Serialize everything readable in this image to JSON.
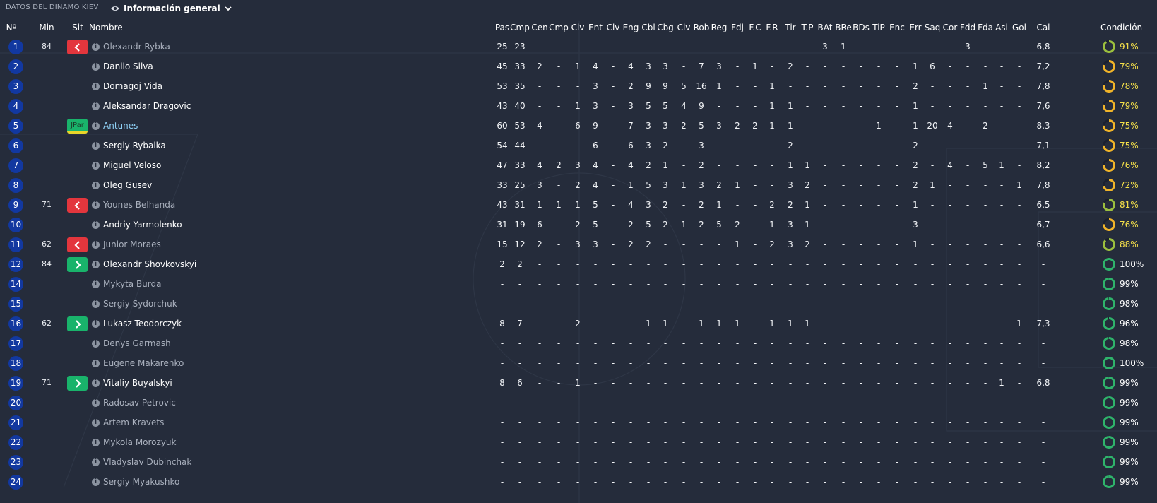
{
  "title": "DATOS DEL DINAMO KIEV",
  "view_selector": {
    "label": "Información general",
    "icon": "eye-icon"
  },
  "columns": [
    "Nº",
    "Min",
    "Sit",
    "Nombre",
    "Pas",
    "Cmp",
    "Cen",
    "Cmp",
    "Clv",
    "Ent",
    "Clv",
    "Eng",
    "Cbl",
    "Cbg",
    "Clv",
    "Rob",
    "Reg",
    "Fdj",
    "F.C",
    "F.R",
    "Tir",
    "T.P",
    "BAt",
    "BRe",
    "BDs",
    "TiP",
    "Enc",
    "Err",
    "Saq",
    "Cor",
    "Fdd",
    "Fda",
    "Asi",
    "Gol",
    "Cal",
    "Condición"
  ],
  "colors": {
    "out": "#e3363d",
    "in": "#19b36b",
    "number_badge": "#1238a0",
    "cond_full": "#2fb36b",
    "cond_mid": "#9cbf3e",
    "cond_low": "#f0b429",
    "cond_text_low": "#f5e04a"
  },
  "players": [
    {
      "num": "1",
      "min": "84",
      "sit": "out",
      "name": "Olexandr Rybka",
      "style": "dim",
      "stats": [
        "25",
        "23",
        "-",
        "-",
        "-",
        "-",
        "-",
        "-",
        "-",
        "-",
        "-",
        "-",
        "-",
        "-",
        "-",
        "-",
        "-",
        "-",
        "3",
        "1",
        "-",
        "-",
        "-",
        "-",
        "-",
        "-",
        "3",
        "-",
        "-",
        "-"
      ],
      "cal": "6,8",
      "cond": 91,
      "cond_text": "91%"
    },
    {
      "num": "2",
      "min": "",
      "sit": "",
      "name": "Danilo Silva",
      "style": "bright",
      "stats": [
        "45",
        "33",
        "2",
        "-",
        "1",
        "4",
        "-",
        "4",
        "3",
        "3",
        "-",
        "7",
        "3",
        "-",
        "1",
        "-",
        "2",
        "-",
        "-",
        "-",
        "-",
        "-",
        "-",
        "1",
        "6",
        "-",
        "-",
        "-",
        "-",
        "-"
      ],
      "cal": "7,2",
      "cond": 79,
      "cond_text": "79%"
    },
    {
      "num": "3",
      "min": "",
      "sit": "",
      "name": "Domagoj Vida",
      "style": "bright",
      "stats": [
        "53",
        "35",
        "-",
        "-",
        "-",
        "3",
        "-",
        "2",
        "9",
        "9",
        "5",
        "16",
        "1",
        "-",
        "-",
        "1",
        "-",
        "-",
        "-",
        "-",
        "-",
        "-",
        "-",
        "2",
        "-",
        "-",
        "-",
        "1",
        "-",
        "-"
      ],
      "cal": "7,8",
      "cond": 78,
      "cond_text": "78%"
    },
    {
      "num": "4",
      "min": "",
      "sit": "",
      "name": "Aleksandar Dragovic",
      "style": "bright",
      "stats": [
        "43",
        "40",
        "-",
        "-",
        "1",
        "3",
        "-",
        "3",
        "5",
        "5",
        "4",
        "9",
        "-",
        "-",
        "-",
        "1",
        "1",
        "-",
        "-",
        "-",
        "-",
        "-",
        "-",
        "1",
        "-",
        "-",
        "-",
        "-",
        "-",
        "-"
      ],
      "cal": "7,6",
      "cond": 79,
      "cond_text": "79%"
    },
    {
      "num": "5",
      "min": "",
      "sit": "tag",
      "sit_label": "JPar",
      "name": "Antunes",
      "style": "link",
      "stats": [
        "60",
        "53",
        "4",
        "-",
        "6",
        "9",
        "-",
        "7",
        "3",
        "3",
        "2",
        "5",
        "3",
        "2",
        "2",
        "1",
        "1",
        "-",
        "-",
        "-",
        "-",
        "1",
        "-",
        "1",
        "20",
        "4",
        "-",
        "2",
        "-",
        "-"
      ],
      "cal": "8,3",
      "cond": 75,
      "cond_text": "75%"
    },
    {
      "num": "6",
      "min": "",
      "sit": "",
      "name": "Sergiy Rybalka",
      "style": "bright",
      "stats": [
        "54",
        "44",
        "-",
        "-",
        "-",
        "6",
        "-",
        "6",
        "3",
        "2",
        "-",
        "3",
        "-",
        "-",
        "-",
        "-",
        "2",
        "-",
        "-",
        "-",
        "-",
        "-",
        "-",
        "2",
        "-",
        "-",
        "-",
        "-",
        "-",
        "-"
      ],
      "cal": "7,1",
      "cond": 75,
      "cond_text": "75%"
    },
    {
      "num": "7",
      "min": "",
      "sit": "",
      "name": "Miguel Veloso",
      "style": "bright",
      "stats": [
        "47",
        "33",
        "4",
        "2",
        "3",
        "4",
        "-",
        "4",
        "2",
        "1",
        "-",
        "2",
        "-",
        "-",
        "-",
        "-",
        "1",
        "1",
        "-",
        "-",
        "-",
        "-",
        "-",
        "2",
        "-",
        "4",
        "-",
        "5",
        "1",
        "-"
      ],
      "cal": "8,2",
      "cond": 76,
      "cond_text": "76%"
    },
    {
      "num": "8",
      "min": "",
      "sit": "",
      "name": "Oleg Gusev",
      "style": "bright",
      "stats": [
        "33",
        "25",
        "3",
        "-",
        "2",
        "4",
        "-",
        "1",
        "5",
        "3",
        "1",
        "3",
        "2",
        "1",
        "-",
        "-",
        "3",
        "2",
        "-",
        "-",
        "-",
        "-",
        "-",
        "2",
        "1",
        "-",
        "-",
        "-",
        "-",
        "1"
      ],
      "cal": "7,8",
      "cond": 72,
      "cond_text": "72%"
    },
    {
      "num": "9",
      "min": "71",
      "sit": "out",
      "name": "Younes Belhanda",
      "style": "dim",
      "stats": [
        "43",
        "31",
        "1",
        "1",
        "1",
        "5",
        "-",
        "4",
        "3",
        "2",
        "-",
        "2",
        "1",
        "-",
        "-",
        "2",
        "2",
        "1",
        "-",
        "-",
        "-",
        "-",
        "-",
        "1",
        "-",
        "-",
        "-",
        "-",
        "-",
        "-"
      ],
      "cal": "6,5",
      "cond": 81,
      "cond_text": "81%"
    },
    {
      "num": "10",
      "min": "",
      "sit": "",
      "name": "Andriy Yarmolenko",
      "style": "bright",
      "stats": [
        "31",
        "19",
        "6",
        "-",
        "2",
        "5",
        "-",
        "2",
        "5",
        "2",
        "1",
        "2",
        "5",
        "2",
        "-",
        "1",
        "3",
        "1",
        "-",
        "-",
        "-",
        "-",
        "-",
        "3",
        "-",
        "-",
        "-",
        "-",
        "-",
        "-"
      ],
      "cal": "6,7",
      "cond": 76,
      "cond_text": "76%"
    },
    {
      "num": "11",
      "min": "62",
      "sit": "out",
      "name": "Junior Moraes",
      "style": "dim",
      "stats": [
        "15",
        "12",
        "2",
        "-",
        "3",
        "3",
        "-",
        "2",
        "2",
        "-",
        "-",
        "-",
        "-",
        "1",
        "-",
        "2",
        "3",
        "2",
        "-",
        "-",
        "-",
        "-",
        "-",
        "1",
        "-",
        "-",
        "-",
        "-",
        "-",
        "-"
      ],
      "cal": "6,6",
      "cond": 88,
      "cond_text": "88%"
    },
    {
      "num": "12",
      "min": "84",
      "sit": "in",
      "name": "Olexandr Shovkovskyi",
      "style": "bright",
      "stats": [
        "2",
        "2",
        "-",
        "-",
        "-",
        "-",
        "-",
        "-",
        "-",
        "-",
        "-",
        "-",
        "-",
        "-",
        "-",
        "-",
        "-",
        "-",
        "-",
        "-",
        "-",
        "-",
        "-",
        "-",
        "-",
        "-",
        "-",
        "-",
        "-",
        "-"
      ],
      "cal": "-",
      "cond": 100,
      "cond_text": "100%"
    },
    {
      "num": "14",
      "min": "",
      "sit": "",
      "name": "Mykyta Burda",
      "style": "dim",
      "stats": [
        "-",
        "-",
        "-",
        "-",
        "-",
        "-",
        "-",
        "-",
        "-",
        "-",
        "-",
        "-",
        "-",
        "-",
        "-",
        "-",
        "-",
        "-",
        "-",
        "-",
        "-",
        "-",
        "-",
        "-",
        "-",
        "-",
        "-",
        "-",
        "-",
        "-"
      ],
      "cal": "-",
      "cond": 99,
      "cond_text": "99%"
    },
    {
      "num": "15",
      "min": "",
      "sit": "",
      "name": "Sergiy Sydorchuk",
      "style": "dim",
      "stats": [
        "-",
        "-",
        "-",
        "-",
        "-",
        "-",
        "-",
        "-",
        "-",
        "-",
        "-",
        "-",
        "-",
        "-",
        "-",
        "-",
        "-",
        "-",
        "-",
        "-",
        "-",
        "-",
        "-",
        "-",
        "-",
        "-",
        "-",
        "-",
        "-",
        "-"
      ],
      "cal": "-",
      "cond": 98,
      "cond_text": "98%"
    },
    {
      "num": "16",
      "min": "62",
      "sit": "in",
      "name": "Lukasz Teodorczyk",
      "style": "bright",
      "stats": [
        "8",
        "7",
        "-",
        "-",
        "2",
        "-",
        "-",
        "-",
        "1",
        "1",
        "-",
        "1",
        "1",
        "1",
        "-",
        "1",
        "1",
        "1",
        "-",
        "-",
        "-",
        "-",
        "-",
        "-",
        "-",
        "-",
        "-",
        "-",
        "-",
        "1"
      ],
      "cal": "7,3",
      "cond": 96,
      "cond_text": "96%"
    },
    {
      "num": "17",
      "min": "",
      "sit": "",
      "name": "Denys Garmash",
      "style": "dim",
      "stats": [
        "-",
        "-",
        "-",
        "-",
        "-",
        "-",
        "-",
        "-",
        "-",
        "-",
        "-",
        "-",
        "-",
        "-",
        "-",
        "-",
        "-",
        "-",
        "-",
        "-",
        "-",
        "-",
        "-",
        "-",
        "-",
        "-",
        "-",
        "-",
        "-",
        "-"
      ],
      "cal": "-",
      "cond": 98,
      "cond_text": "98%"
    },
    {
      "num": "18",
      "min": "",
      "sit": "",
      "name": "Eugene Makarenko",
      "style": "dim",
      "stats": [
        "-",
        "-",
        "-",
        "-",
        "-",
        "-",
        "-",
        "-",
        "-",
        "-",
        "-",
        "-",
        "-",
        "-",
        "-",
        "-",
        "-",
        "-",
        "-",
        "-",
        "-",
        "-",
        "-",
        "-",
        "-",
        "-",
        "-",
        "-",
        "-",
        "-"
      ],
      "cal": "-",
      "cond": 100,
      "cond_text": "100%"
    },
    {
      "num": "19",
      "min": "71",
      "sit": "in",
      "name": "Vitaliy Buyalskyi",
      "style": "bright",
      "stats": [
        "8",
        "6",
        "-",
        "-",
        "1",
        "-",
        "-",
        "-",
        "-",
        "-",
        "-",
        "-",
        "-",
        "-",
        "-",
        "-",
        "-",
        "-",
        "-",
        "-",
        "-",
        "-",
        "-",
        "-",
        "-",
        "-",
        "-",
        "-",
        "1",
        "-"
      ],
      "cal": "6,8",
      "cond": 99,
      "cond_text": "99%"
    },
    {
      "num": "20",
      "min": "",
      "sit": "",
      "name": "Radosav Petrovic",
      "style": "dim",
      "stats": [
        "-",
        "-",
        "-",
        "-",
        "-",
        "-",
        "-",
        "-",
        "-",
        "-",
        "-",
        "-",
        "-",
        "-",
        "-",
        "-",
        "-",
        "-",
        "-",
        "-",
        "-",
        "-",
        "-",
        "-",
        "-",
        "-",
        "-",
        "-",
        "-",
        "-"
      ],
      "cal": "-",
      "cond": 99,
      "cond_text": "99%"
    },
    {
      "num": "21",
      "min": "",
      "sit": "",
      "name": "Artem Kravets",
      "style": "dim",
      "stats": [
        "-",
        "-",
        "-",
        "-",
        "-",
        "-",
        "-",
        "-",
        "-",
        "-",
        "-",
        "-",
        "-",
        "-",
        "-",
        "-",
        "-",
        "-",
        "-",
        "-",
        "-",
        "-",
        "-",
        "-",
        "-",
        "-",
        "-",
        "-",
        "-",
        "-"
      ],
      "cal": "-",
      "cond": 99,
      "cond_text": "99%"
    },
    {
      "num": "22",
      "min": "",
      "sit": "",
      "name": "Mykola Morozyuk",
      "style": "dim",
      "stats": [
        "-",
        "-",
        "-",
        "-",
        "-",
        "-",
        "-",
        "-",
        "-",
        "-",
        "-",
        "-",
        "-",
        "-",
        "-",
        "-",
        "-",
        "-",
        "-",
        "-",
        "-",
        "-",
        "-",
        "-",
        "-",
        "-",
        "-",
        "-",
        "-",
        "-"
      ],
      "cal": "-",
      "cond": 99,
      "cond_text": "99%"
    },
    {
      "num": "23",
      "min": "",
      "sit": "",
      "name": "Vladyslav Dubinchak",
      "style": "dim",
      "stats": [
        "-",
        "-",
        "-",
        "-",
        "-",
        "-",
        "-",
        "-",
        "-",
        "-",
        "-",
        "-",
        "-",
        "-",
        "-",
        "-",
        "-",
        "-",
        "-",
        "-",
        "-",
        "-",
        "-",
        "-",
        "-",
        "-",
        "-",
        "-",
        "-",
        "-"
      ],
      "cal": "-",
      "cond": 99,
      "cond_text": "99%"
    },
    {
      "num": "24",
      "min": "",
      "sit": "",
      "name": "Sergiy Myakushko",
      "style": "dim",
      "stats": [
        "-",
        "-",
        "-",
        "-",
        "-",
        "-",
        "-",
        "-",
        "-",
        "-",
        "-",
        "-",
        "-",
        "-",
        "-",
        "-",
        "-",
        "-",
        "-",
        "-",
        "-",
        "-",
        "-",
        "-",
        "-",
        "-",
        "-",
        "-",
        "-",
        "-"
      ],
      "cal": "-",
      "cond": 99,
      "cond_text": "99%"
    }
  ]
}
